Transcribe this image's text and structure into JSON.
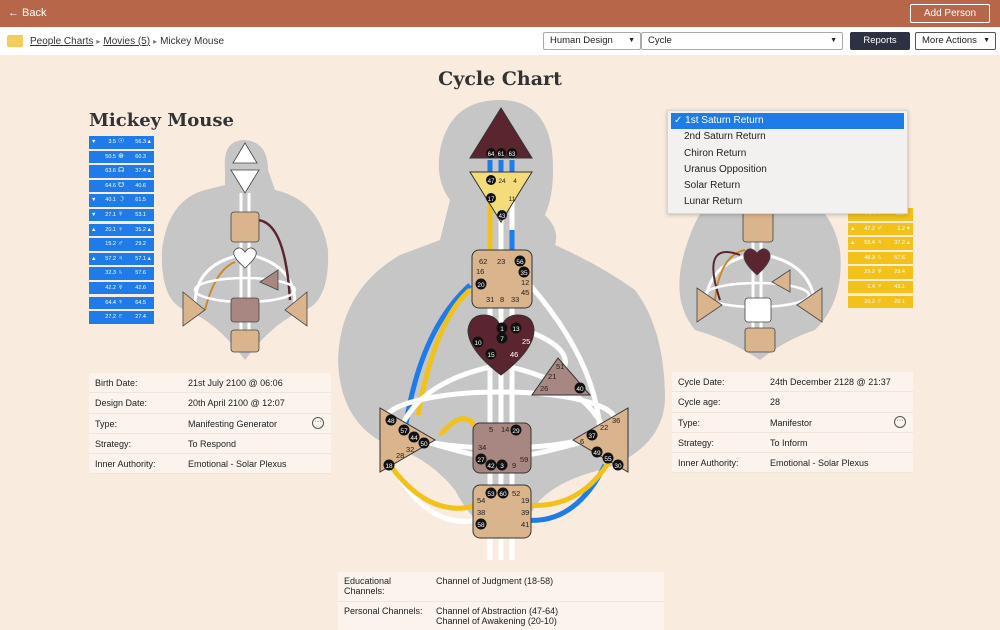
{
  "topbar": {
    "back_label": "← Back",
    "add_person_label": "Add Person"
  },
  "breadcrumb": {
    "item1": "People Charts",
    "item2": "Movies (5)",
    "current": "Mickey Mouse"
  },
  "toolbar": {
    "system_select": "Human Design",
    "chart_select": "Cycle",
    "reports_label": "Reports",
    "more_actions_label": "More Actions"
  },
  "page": {
    "title": "Cycle Chart"
  },
  "person": {
    "name": "Mickey Mouse"
  },
  "colors": {
    "topbar": "#b8664a",
    "blue": "#1e7be8",
    "yellow": "#f2c21b",
    "background": "#f9ecdf"
  },
  "design_planets": [
    {
      "arrow": "▼",
      "v1": "3.5",
      "glyph": "☉",
      "v2": "56.3",
      "arrow2": "▲"
    },
    {
      "arrow": "",
      "v1": "50.5",
      "glyph": "⊕",
      "v2": "60.3",
      "arrow2": ""
    },
    {
      "arrow": "",
      "v1": "63.6",
      "glyph": "☊",
      "v2": "37.4",
      "arrow2": "▲"
    },
    {
      "arrow": "",
      "v1": "64.6",
      "glyph": "☋",
      "v2": "40.6",
      "arrow2": ""
    },
    {
      "arrow": "▼",
      "v1": "40.1",
      "glyph": "☽",
      "v2": "61.5",
      "arrow2": ""
    },
    {
      "arrow": "▼",
      "v1": "27.1",
      "glyph": "☿",
      "v2": "53.1",
      "arrow2": ""
    },
    {
      "arrow": "▲",
      "v1": "20.1",
      "glyph": "♀",
      "v2": "35.2",
      "arrow2": "▲"
    },
    {
      "arrow": "",
      "v1": "15.2",
      "glyph": "♂",
      "v2": "29.2",
      "arrow2": ""
    },
    {
      "arrow": "▲",
      "v1": "57.2",
      "glyph": "♃",
      "v2": "57.1",
      "arrow2": "▲"
    },
    {
      "arrow": "",
      "v1": "32.3",
      "glyph": "♄",
      "v2": "57.6",
      "arrow2": ""
    },
    {
      "arrow": "",
      "v1": "42.2",
      "glyph": "♅",
      "v2": "42.6",
      "arrow2": ""
    },
    {
      "arrow": "",
      "v1": "64.4",
      "glyph": "♆",
      "v2": "64.5",
      "arrow2": ""
    },
    {
      "arrow": "",
      "v1": "27.2",
      "glyph": "♇",
      "v2": "27.4",
      "arrow2": ""
    }
  ],
  "cycle_planets": [
    {
      "arrow": "",
      "v1": "44.4",
      "glyph": "♀",
      "v2": "45.2",
      "arrow2": ""
    },
    {
      "arrow": "▲",
      "v1": "47.2",
      "glyph": "♂",
      "v2": "1.2",
      "arrow2": "▼"
    },
    {
      "arrow": "▲",
      "v1": "55.4",
      "glyph": "♃",
      "v2": "37.2",
      "arrow2": "▲"
    },
    {
      "arrow": "",
      "v1": "48.3",
      "glyph": "♄",
      "v2": "57.6",
      "arrow2": ""
    },
    {
      "arrow": "",
      "v1": "29.2",
      "glyph": "♅",
      "v2": "29.4",
      "arrow2": ""
    },
    {
      "arrow": "",
      "v1": "1.4",
      "glyph": "♆",
      "v2": "43.1",
      "arrow2": ""
    },
    {
      "arrow": "",
      "v1": "20.2",
      "glyph": "♇",
      "v2": "20.1",
      "arrow2": ""
    }
  ],
  "birth_info": {
    "birth_date_label": "Birth Date:",
    "birth_date": "21st July 2100 @ 06:06",
    "design_date_label": "Design Date:",
    "design_date": "20th April 2100 @ 12:07",
    "type_label": "Type:",
    "type": "Manifesting Generator",
    "strategy_label": "Strategy:",
    "strategy": "To Respond",
    "authority_label": "Inner Authority:",
    "authority": "Emotional - Solar Plexus"
  },
  "cycle_info": {
    "cycle_date_label": "Cycle Date:",
    "cycle_date": "24th December 2128 @ 21:37",
    "cycle_age_label": "Cycle age:",
    "cycle_age": "28",
    "type_label": "Type:",
    "type": "Manifestor",
    "strategy_label": "Strategy:",
    "strategy": "To Inform",
    "authority_label": "Inner Authority:",
    "authority": "Emotional - Solar Plexus"
  },
  "channels": {
    "educational_label": "Educational Channels:",
    "educational": "Channel of Judgment (18-58)",
    "personal_label": "Personal Channels:",
    "personal_1": "Channel of Abstraction (47-64)",
    "personal_2": "Channel of Awakening (20-10)"
  },
  "cycle_dropdown": {
    "options": [
      "✓ 1st Saturn Return",
      "2nd Saturn Return",
      "Chiron Return",
      "Uranus Opposition",
      "Solar Return",
      "Lunar Return"
    ]
  },
  "bodygraph": {
    "head_gates": [
      "64",
      "61",
      "63"
    ],
    "ajna_gates": [
      "47",
      "24",
      "4",
      "17",
      "11",
      "43"
    ],
    "throat_gates": [
      "62",
      "23",
      "56",
      "16",
      "35",
      "20",
      "12",
      "45",
      "31",
      "8",
      "33"
    ],
    "g_gates": [
      "7",
      "1",
      "13",
      "10",
      "25",
      "15",
      "46"
    ],
    "ego_gates": [
      "51",
      "21",
      "26",
      "40"
    ],
    "spleen_gates": [
      "48",
      "57",
      "44",
      "50",
      "32",
      "28",
      "18"
    ],
    "sacral_gates": [
      "5",
      "14",
      "29",
      "34",
      "27",
      "59",
      "42",
      "3",
      "9"
    ],
    "solar_gates": [
      "36",
      "22",
      "37",
      "6",
      "49",
      "55",
      "30"
    ],
    "root_gates": [
      "53",
      "60",
      "52",
      "54",
      "19",
      "38",
      "39",
      "58",
      "41"
    ]
  }
}
